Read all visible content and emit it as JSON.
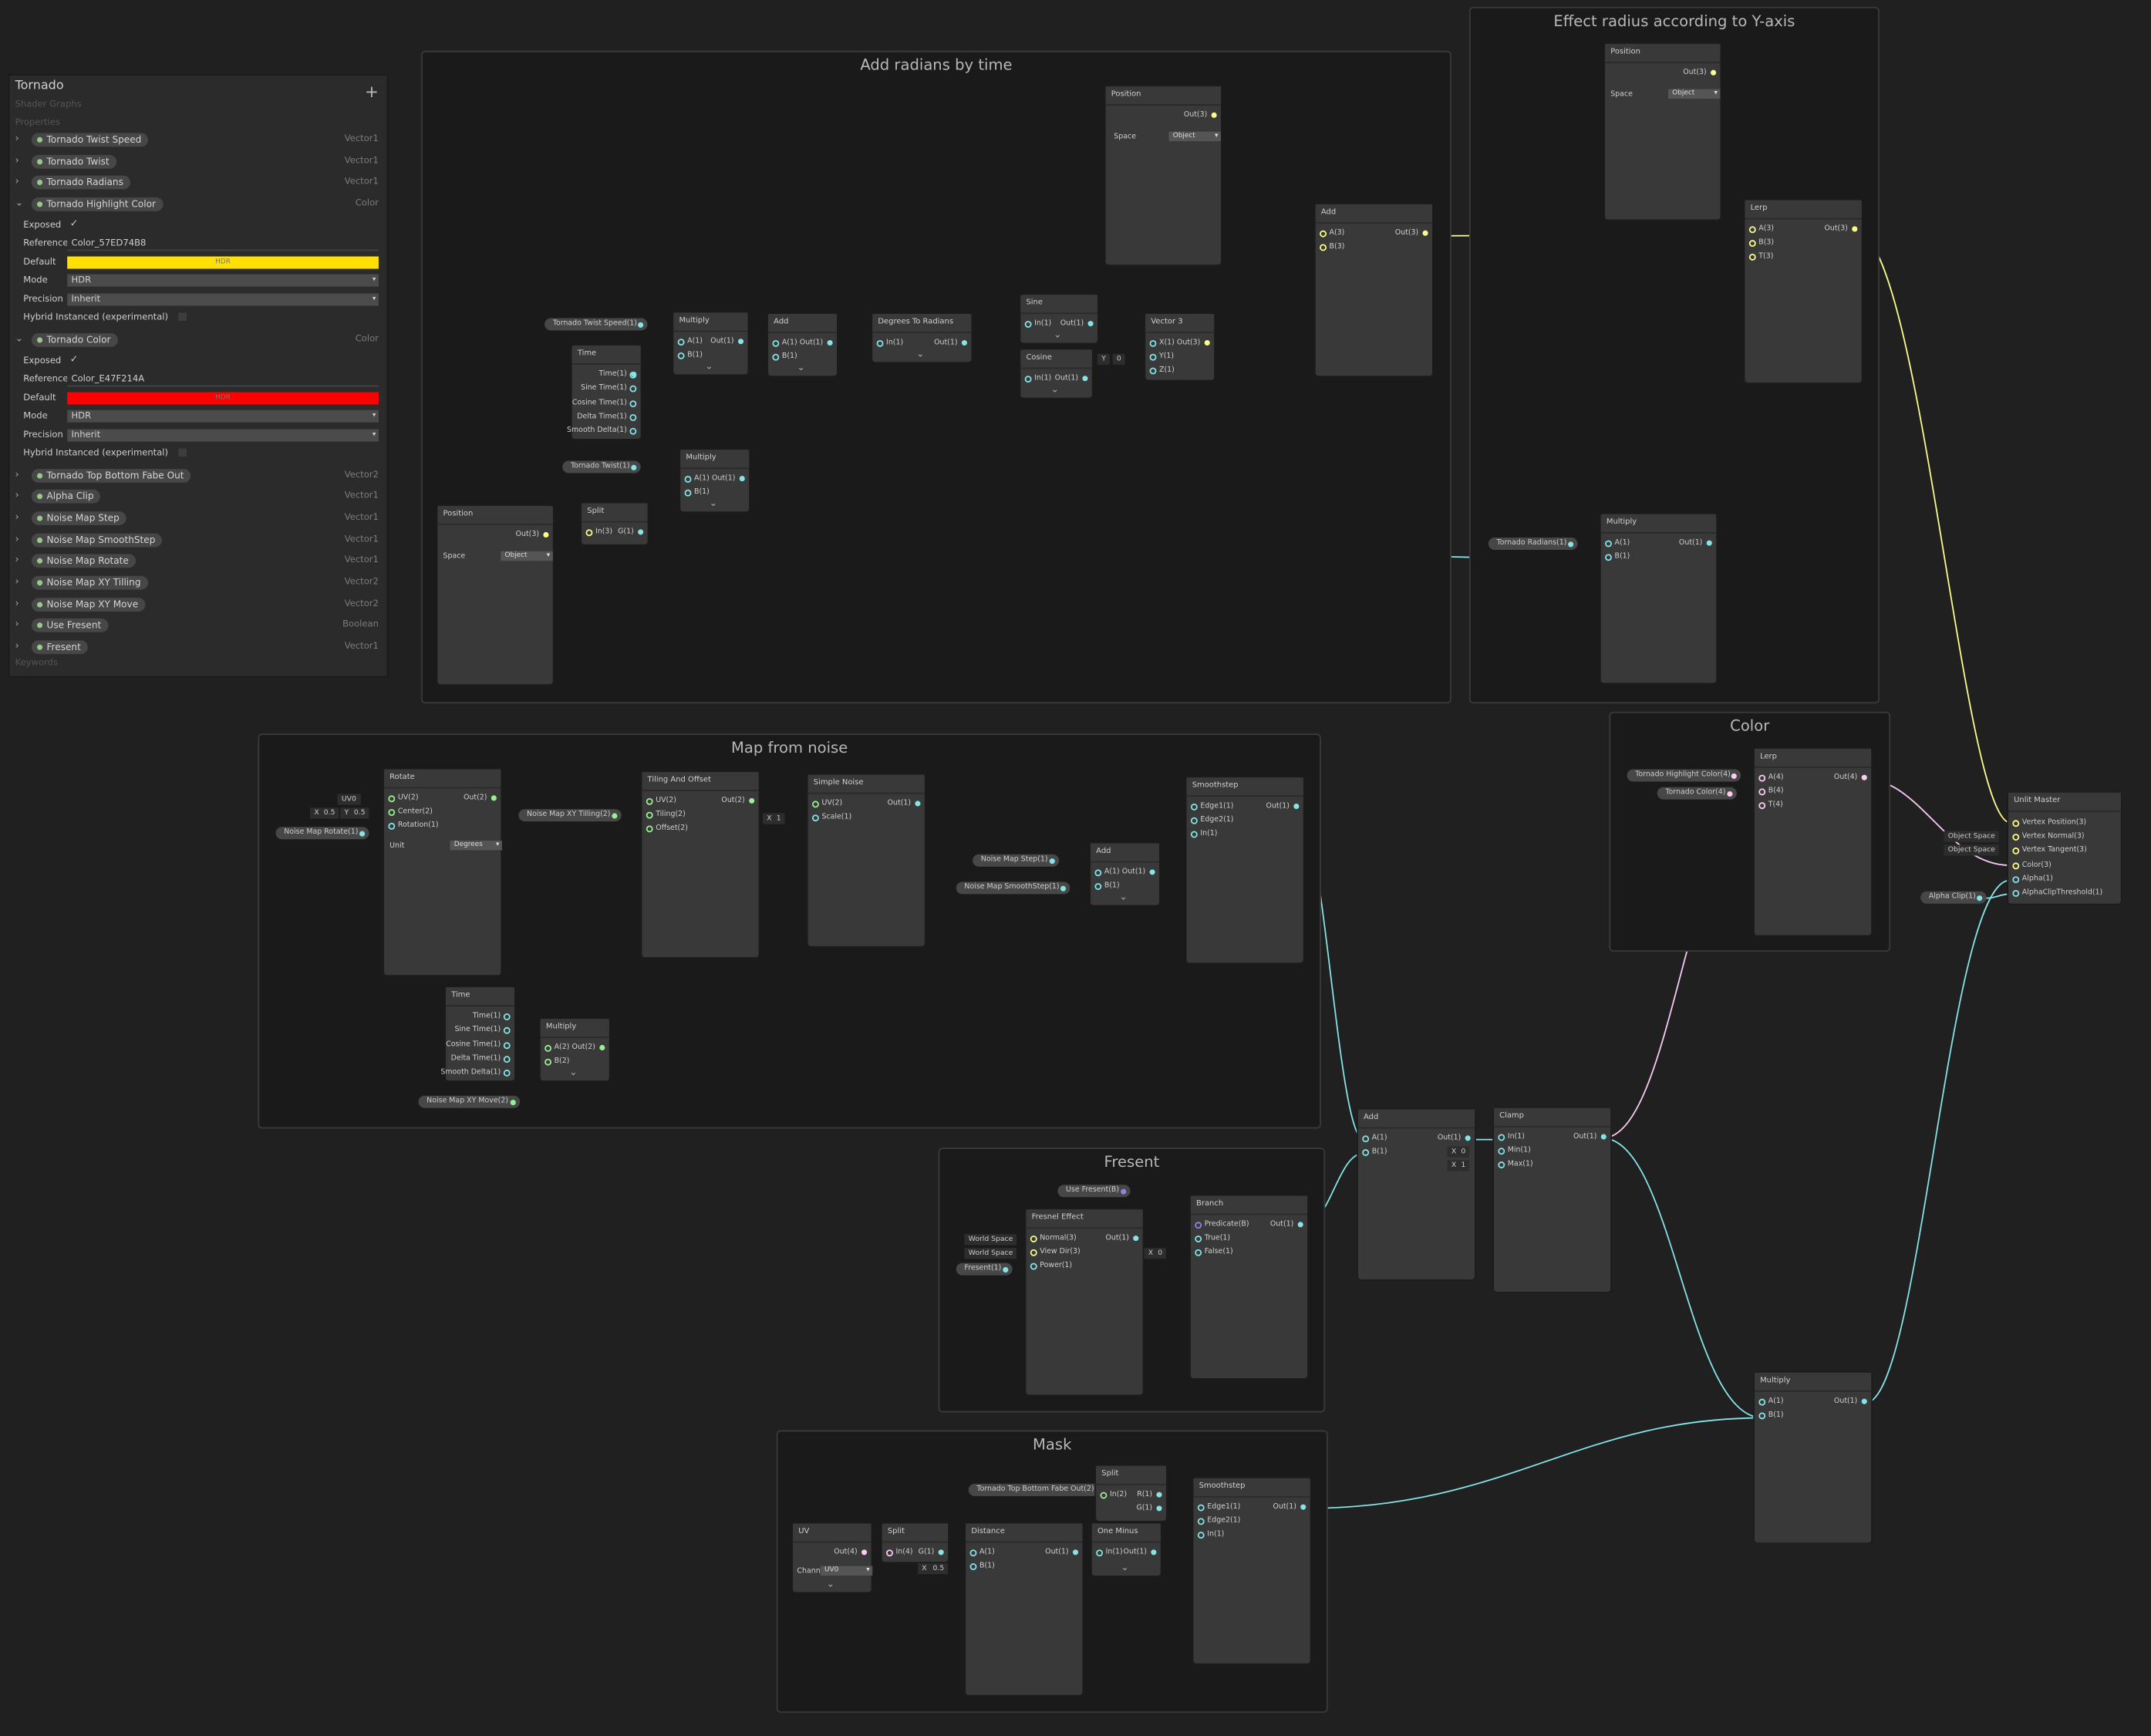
{
  "blackboard": {
    "title": "Tornado",
    "subtitle": "Shader Graphs",
    "add_icon": "+",
    "properties_label": "Properties",
    "keywords_label": "Keywords",
    "properties": [
      {
        "name": "Tornado Twist Speed",
        "type": "Vector1"
      },
      {
        "name": "Tornado Twist",
        "type": "Vector1"
      },
      {
        "name": "Tornado Radians",
        "type": "Vector1"
      },
      {
        "name": "Tornado Highlight Color",
        "type": "Color",
        "expanded": true,
        "exposed_label": "Exposed",
        "exposed": "✓",
        "reference_label": "Reference",
        "reference": "Color_57ED74B8",
        "default_label": "Default",
        "default_color": "#ffe000",
        "default_text": "HDR",
        "mode_label": "Mode",
        "mode": "HDR",
        "precision_label": "Precision",
        "precision": "Inherit",
        "hybrid_label": "Hybrid Instanced (experimental)"
      },
      {
        "name": "Tornado Color",
        "type": "Color",
        "expanded": true,
        "exposed_label": "Exposed",
        "exposed": "✓",
        "reference_label": "Reference",
        "reference": "Color_E47F214A",
        "default_label": "Default",
        "default_color": "#ff0000",
        "default_text": "HDR",
        "mode_label": "Mode",
        "mode": "HDR",
        "precision_label": "Precision",
        "precision": "Inherit",
        "hybrid_label": "Hybrid Instanced (experimental)"
      },
      {
        "name": "Tornado Top Bottom Fabe Out",
        "type": "Vector2"
      },
      {
        "name": "Alpha Clip",
        "type": "Vector1"
      },
      {
        "name": "Noise Map Step",
        "type": "Vector1"
      },
      {
        "name": "Noise Map SmoothStep",
        "type": "Vector1"
      },
      {
        "name": "Noise Map Rotate",
        "type": "Vector1"
      },
      {
        "name": "Noise Map XY Tilling",
        "type": "Vector2"
      },
      {
        "name": "Noise Map XY Move",
        "type": "Vector2"
      },
      {
        "name": "Use Fresent",
        "type": "Boolean"
      },
      {
        "name": "Fresent",
        "type": "Vector1"
      }
    ]
  },
  "groups": {
    "add_radians": "Add radians by time",
    "effect_radius": "Effect radius according to Y-axis",
    "map_noise": "Map from noise",
    "color": "Color",
    "fresent": "Fresent",
    "mask": "Mask"
  },
  "colors": {
    "vector1": "#84e4e7",
    "vector3": "#fcfe89",
    "vector2": "#9aef92",
    "vector4": "#fbcbf4",
    "boolean": "#9481e6"
  },
  "nodes": {
    "position1": {
      "title": "Position",
      "out": "Out(3)",
      "space_label": "Space",
      "space": "Object"
    },
    "position2": {
      "title": "Position",
      "out": "Out(3)",
      "space_label": "Space",
      "space": "Object"
    },
    "position3": {
      "title": "Position",
      "out": "Out(3)",
      "space_label": "Space",
      "space": "Object"
    },
    "add1": {
      "title": "Add",
      "a": "A(3)",
      "b": "B(3)",
      "out": "Out(3)"
    },
    "lerp1": {
      "title": "Lerp",
      "a": "A(3)",
      "b": "B(3)",
      "t": "T(3)",
      "out": "Out(3)"
    },
    "multiply_radians": {
      "title": "Multiply",
      "a": "A(1)",
      "b": "B(1)",
      "out": "Out(1)"
    },
    "multiply1": {
      "title": "Multiply",
      "a": "A(1)",
      "b": "B(1)",
      "out": "Out(1)"
    },
    "multiply2": {
      "title": "Multiply",
      "a": "A(1)",
      "b": "B(1)",
      "out": "Out(1)"
    },
    "add2": {
      "title": "Add",
      "a": "A(1)",
      "b": "B(1)",
      "out": "Out(1)"
    },
    "deg2rad": {
      "title": "Degrees To Radians",
      "in": "In(1)",
      "out": "Out(1)"
    },
    "sine": {
      "title": "Sine",
      "in": "In(1)",
      "out": "Out(1)"
    },
    "cosine": {
      "title": "Cosine",
      "in": "In(1)",
      "out": "Out(1)"
    },
    "vector3": {
      "title": "Vector 3",
      "x": "X(1)",
      "y": "Y(1)",
      "z": "Z(1)",
      "out": "Out(3)",
      "y_label": "Y",
      "y_value": "0"
    },
    "time1": {
      "title": "Time",
      "ports": [
        "Time(1)",
        "Sine Time(1)",
        "Cosine Time(1)",
        "Delta Time(1)",
        "Smooth Delta(1)"
      ]
    },
    "time2": {
      "title": "Time",
      "ports": [
        "Time(1)",
        "Sine Time(1)",
        "Cosine Time(1)",
        "Delta Time(1)",
        "Smooth Delta(1)"
      ]
    },
    "split1": {
      "title": "Split",
      "in": "In(3)",
      "out": "G(1)"
    },
    "rotate": {
      "title": "Rotate",
      "uv": "UV(2)",
      "center": "Center(2)",
      "rotation": "Rotation(1)",
      "out": "Out(2)",
      "unit_label": "Unit",
      "unit": "Degrees",
      "uv_in": "UV0",
      "cx_label": "X",
      "cx": "0.5",
      "cy_label": "Y",
      "cy": "0.5"
    },
    "tiling": {
      "title": "Tiling And Offset",
      "uv": "UV(2)",
      "tiling": "Tiling(2)",
      "offset": "Offset(2)",
      "out": "Out(2)"
    },
    "noise": {
      "title": "Simple Noise",
      "uv": "UV(2)",
      "scale": "Scale(1)",
      "out": "Out(1)",
      "scale_label": "X",
      "scale_value": "1"
    },
    "smoothstep1": {
      "title": "Smoothstep",
      "e1": "Edge1(1)",
      "e2": "Edge2(1)",
      "in": "In(1)",
      "out": "Out(1)"
    },
    "add3": {
      "title": "Add",
      "a": "A(1)",
      "b": "B(1)",
      "out": "Out(1)"
    },
    "multiply_time": {
      "title": "Multiply",
      "a": "A(2)",
      "b": "B(2)",
      "out": "Out(2)"
    },
    "lerp2": {
      "title": "Lerp",
      "a": "A(4)",
      "b": "B(4)",
      "t": "T(4)",
      "out": "Out(4)"
    },
    "master": {
      "title": "Unlit Master",
      "ports": [
        "Vertex Position(3)",
        "Vertex Normal(3)",
        "Vertex Tangent(3)",
        "Color(3)",
        "Alpha(1)",
        "AlphaClipThreshold(1)"
      ],
      "space1": "Object Space",
      "space2": "Object Space"
    },
    "add4": {
      "title": "Add",
      "a": "A(1)",
      "b": "B(1)",
      "out": "Out(1)"
    },
    "clamp": {
      "title": "Clamp",
      "in": "In(1)",
      "min": "Min(1)",
      "max": "Max(1)",
      "out": "Out(1)",
      "min_label": "X",
      "min_value": "0",
      "max_label": "X",
      "max_value": "1"
    },
    "fresnel": {
      "title": "Fresnel Effect",
      "normal": "Normal(3)",
      "view": "View Dir(3)",
      "power": "Power(1)",
      "out": "Out(1)",
      "ws1": "World Space",
      "ws2": "World Space"
    },
    "branch": {
      "title": "Branch",
      "pred": "Predicate(B)",
      "true": "True(1)",
      "false": "False(1)",
      "out": "Out(1)",
      "false_label": "X",
      "false_value": "0"
    },
    "multiply_final": {
      "title": "Multiply",
      "a": "A(1)",
      "b": "B(1)",
      "out": "Out(1)"
    },
    "uv": {
      "title": "UV",
      "out": "Out(4)",
      "channel_label": "Channel",
      "channel": "UV0"
    },
    "split2": {
      "title": "Split",
      "in": "In(4)",
      "out": "G(1)"
    },
    "distance": {
      "title": "Distance",
      "a": "A(1)",
      "b": "B(1)",
      "out": "Out(1)",
      "b_label": "X",
      "b_value": "0.5"
    },
    "oneminus": {
      "title": "One Minus",
      "in": "In(1)",
      "out": "Out(1)"
    },
    "split3": {
      "title": "Split",
      "in": "In(2)",
      "r": "R(1)",
      "g": "G(1)"
    },
    "smoothstep2": {
      "title": "Smoothstep",
      "e1": "Edge1(1)",
      "e2": "Edge2(1)",
      "in": "In(1)",
      "out": "Out(1)"
    }
  },
  "pills": {
    "twist_speed": "Tornado Twist Speed(1)",
    "twist": "Tornado Twist(1)",
    "radians": "Tornado Radians(1)",
    "noise_rotate": "Noise Map Rotate(1)",
    "xy_tilling": "Noise Map XY Tilling(2)",
    "xy_move": "Noise Map XY Move(2)",
    "noise_step": "Noise Map Step(1)",
    "noise_smoothstep": "Noise Map SmoothStep(1)",
    "highlight": "Tornado Highlight Color(4)",
    "tornado_color": "Tornado Color(4)",
    "alpha_clip": "Alpha Clip(1)",
    "use_fresent": "Use Fresent(B)",
    "fresent": "Fresent(1)",
    "topbottom": "Tornado Top Bottom Fabe Out(2)"
  }
}
